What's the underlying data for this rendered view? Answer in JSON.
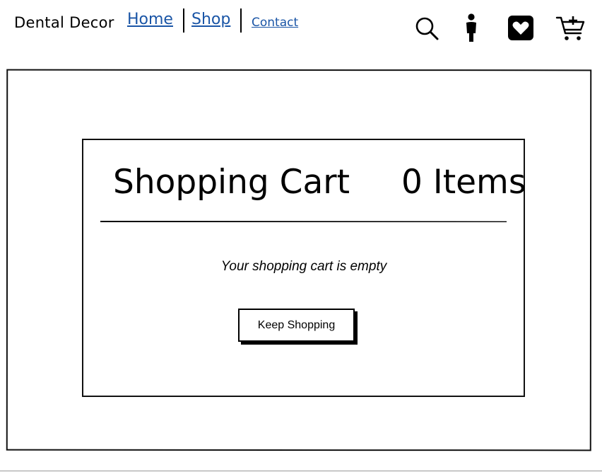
{
  "header": {
    "brand": "Dental Decor",
    "nav": {
      "home": "Home",
      "shop": "Shop",
      "contact": "Contact"
    },
    "icons": [
      "search-icon",
      "account-icon",
      "wishlist-heart-icon",
      "add-to-cart-icon"
    ]
  },
  "cart": {
    "title": "Shopping Cart",
    "count_label": "0 Items",
    "empty_message": "Your shopping cart is empty",
    "keep_shopping_label": "Keep Shopping"
  },
  "colors": {
    "link": "#1a55a6",
    "text": "#000000",
    "background": "#ffffff"
  }
}
